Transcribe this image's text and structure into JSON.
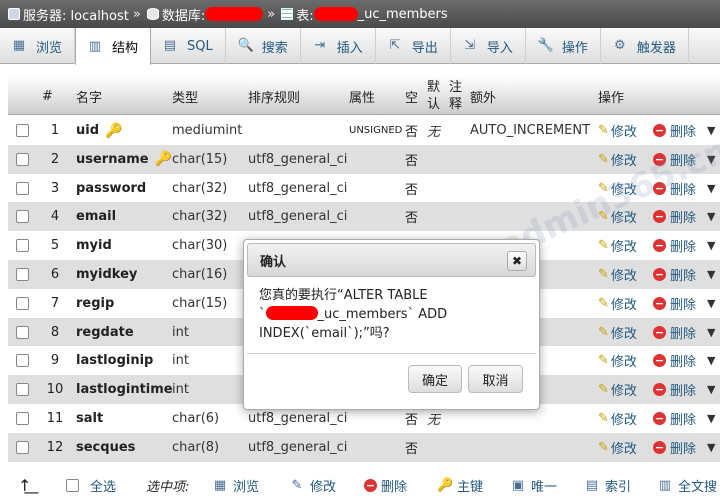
{
  "breadcrumb": {
    "server_label": "服务器: localhost",
    "sep": "»",
    "db_label": "数据库:",
    "db_suffix": "",
    "table_label": "表:",
    "table_suffix": "_uc_members"
  },
  "tabs": [
    {
      "label": "浏览",
      "icon": "▦"
    },
    {
      "label": "结构",
      "icon": "▥"
    },
    {
      "label": "SQL",
      "icon": "▤"
    },
    {
      "label": "搜索",
      "icon": "🔍"
    },
    {
      "label": "插入",
      "icon": "⇥"
    },
    {
      "label": "导出",
      "icon": "⇱"
    },
    {
      "label": "导入",
      "icon": "⇲"
    },
    {
      "label": "操作",
      "icon": "🔧"
    },
    {
      "label": "触发器",
      "icon": "⚙"
    }
  ],
  "columns": {
    "num": "#",
    "name": "名字",
    "type": "类型",
    "collation": "排序规则",
    "attributes": "属性",
    "null": "空",
    "default": "默认",
    "comments": "注释",
    "extra": "额外",
    "action": "操作"
  },
  "rows": [
    {
      "num": "1",
      "name": "uid",
      "type": "mediumint",
      "collation": "",
      "attr": "UNSIGNED",
      "null": "否",
      "default": "无",
      "extra": "AUTO_INCREMENT",
      "key": "primary"
    },
    {
      "num": "2",
      "name": "username",
      "type": "char(15)",
      "collation": "utf8_general_ci",
      "attr": "",
      "null": "否",
      "default": "",
      "extra": "",
      "key": "index"
    },
    {
      "num": "3",
      "name": "password",
      "type": "char(32)",
      "collation": "utf8_general_ci",
      "attr": "",
      "null": "否",
      "default": "",
      "extra": "",
      "key": ""
    },
    {
      "num": "4",
      "name": "email",
      "type": "char(32)",
      "collation": "utf8_general_ci",
      "attr": "",
      "null": "否",
      "default": "",
      "extra": "",
      "key": ""
    },
    {
      "num": "5",
      "name": "myid",
      "type": "char(30)",
      "collation": "",
      "attr": "",
      "null": "",
      "default": "",
      "extra": "",
      "key": ""
    },
    {
      "num": "6",
      "name": "myidkey",
      "type": "char(16)",
      "collation": "",
      "attr": "",
      "null": "",
      "default": "",
      "extra": "",
      "key": ""
    },
    {
      "num": "7",
      "name": "regip",
      "type": "char(15)",
      "collation": "",
      "attr": "",
      "null": "",
      "default": "",
      "extra": "",
      "key": ""
    },
    {
      "num": "8",
      "name": "regdate",
      "type": "int",
      "collation": "",
      "attr": "",
      "null": "",
      "default": "",
      "extra": "",
      "key": ""
    },
    {
      "num": "9",
      "name": "lastloginip",
      "type": "int",
      "collation": "",
      "attr": "",
      "null": "",
      "default": "",
      "extra": "",
      "key": ""
    },
    {
      "num": "10",
      "name": "lastlogintime",
      "type": "int",
      "collation": "",
      "attr": "",
      "null": "",
      "default": "",
      "extra": "",
      "key": ""
    },
    {
      "num": "11",
      "name": "salt",
      "type": "char(6)",
      "collation": "utf8_general_ci",
      "attr": "",
      "null": "否",
      "default": "无",
      "extra": "",
      "key": ""
    },
    {
      "num": "12",
      "name": "secques",
      "type": "char(8)",
      "collation": "utf8_general_ci",
      "attr": "",
      "null": "否",
      "default": "",
      "extra": "",
      "key": ""
    }
  ],
  "row_actions": {
    "edit": "修改",
    "drop": "删除"
  },
  "bottom": {
    "select_all": "全选",
    "with_selected": "选中项:",
    "browse": "浏览",
    "edit": "修改",
    "drop": "删除",
    "primary": "主键",
    "unique": "唯一",
    "index": "索引",
    "fulltext": "全文搜"
  },
  "dialog": {
    "title": "确认",
    "close_glyph": "✖",
    "msg_line1": "您真的要执行“ALTER TABLE",
    "msg_line2_prefix": "`",
    "msg_line2_suffix": "_uc_members` ADD",
    "msg_line3": "INDEX(`email`);”吗?",
    "ok_label": "确定",
    "cancel_label": "取消"
  },
  "watermark": "www.admin365.cn"
}
